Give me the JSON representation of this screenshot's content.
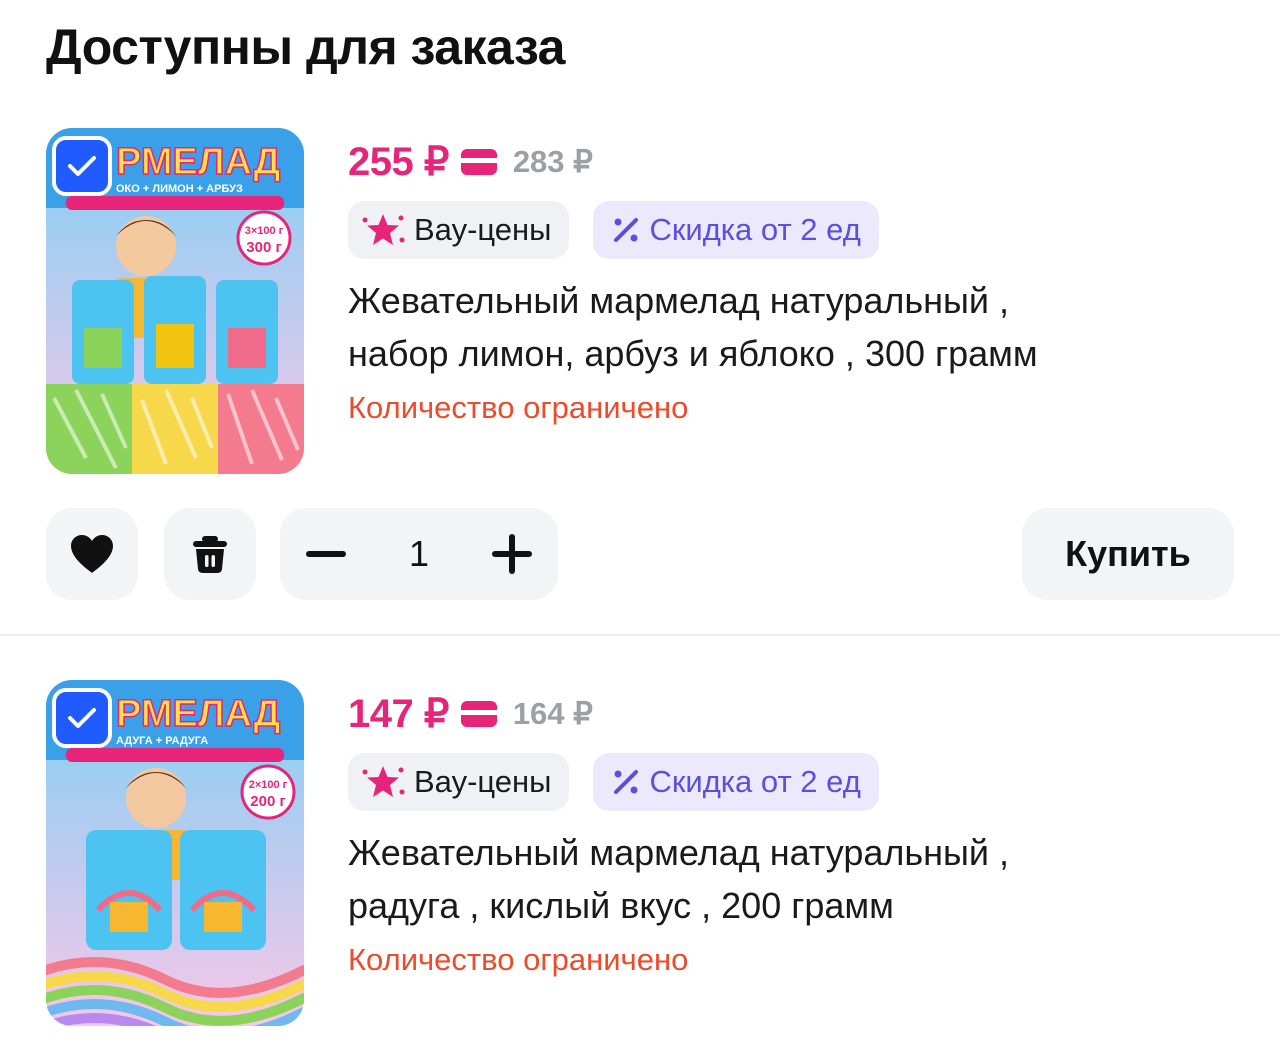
{
  "section": {
    "title": "Доступны для заказа"
  },
  "colors": {
    "price": "#e6247a",
    "accent": "#1f5bff",
    "discount": "#5b4ee0",
    "limited": "#ea4c2c"
  },
  "products": [
    {
      "selected": true,
      "thumb_logo": "РМЕЛАД",
      "thumb_flavors": "ОКО + ЛИМОН + АРБУЗ",
      "thumb_pack": "3×100 г",
      "thumb_weight": "300 г",
      "price": "255 ₽",
      "old_price": "283 ₽",
      "badge_wow": "Вау-цены",
      "badge_discount": "Скидка от 2 ед",
      "title_line1": "Жевательный мармелад натуральный ,",
      "title_line2": "набор лимон, арбуз и яблоко , 300 грамм",
      "limited": "Количество ограничено",
      "quantity": "1",
      "buy_label": "Купить"
    },
    {
      "selected": true,
      "thumb_logo": "РМЕЛАД",
      "thumb_flavors": "АДУГА + РАДУГА",
      "thumb_pack": "2×100 г",
      "thumb_weight": "200 г",
      "price": "147 ₽",
      "old_price": "164 ₽",
      "badge_wow": "Вау-цены",
      "badge_discount": "Скидка от 2 ед",
      "title_line1": "Жевательный мармелад натуральный ,",
      "title_line2": "радуга , кислый вкус , 200 грамм",
      "limited": "Количество ограничено"
    }
  ],
  "icons": {
    "check": "checkbox-checked-icon",
    "card": "card-icon",
    "star": "wow-star-icon",
    "percent": "percent-icon",
    "heart": "heart-icon",
    "trash": "trash-icon",
    "minus": "minus-icon",
    "plus": "plus-icon"
  }
}
